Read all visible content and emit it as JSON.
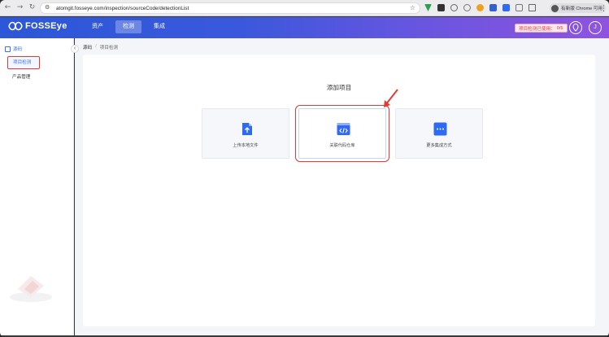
{
  "browser": {
    "url": "atomgit.fosseye.com/inspection/sourceCode/detectionList",
    "profile_label": "有新版 Chrome 可用"
  },
  "header": {
    "logo_text": "FOSSEye",
    "nav": [
      {
        "label": "资产",
        "active": false
      },
      {
        "label": "检测",
        "active": true
      },
      {
        "label": "集成",
        "active": false
      }
    ],
    "quota_label": "项目检测已使用：",
    "quota_value": "0/5",
    "avatar_initial": "J"
  },
  "sidebar": {
    "group_label": "源码",
    "items": [
      {
        "label": "项目检测",
        "active": true
      },
      {
        "label": "产品管理",
        "active": false
      }
    ]
  },
  "main": {
    "breadcrumb": [
      "源码",
      "项目检测"
    ],
    "title": "添加项目",
    "tiles": [
      {
        "label": "上传本地文件",
        "icon": "upload-file-icon",
        "selected": false,
        "color": "#2f6bf2"
      },
      {
        "label": "关联代码仓库",
        "icon": "code-repository-icon",
        "selected": true,
        "color": "#2f6bf2"
      },
      {
        "label": "更多集成方式",
        "icon": "more-integrations-icon",
        "selected": false,
        "color": "#2f6bf2"
      }
    ]
  },
  "colors": {
    "accent": "#3b6ff6",
    "highlight_red": "#e53935"
  }
}
